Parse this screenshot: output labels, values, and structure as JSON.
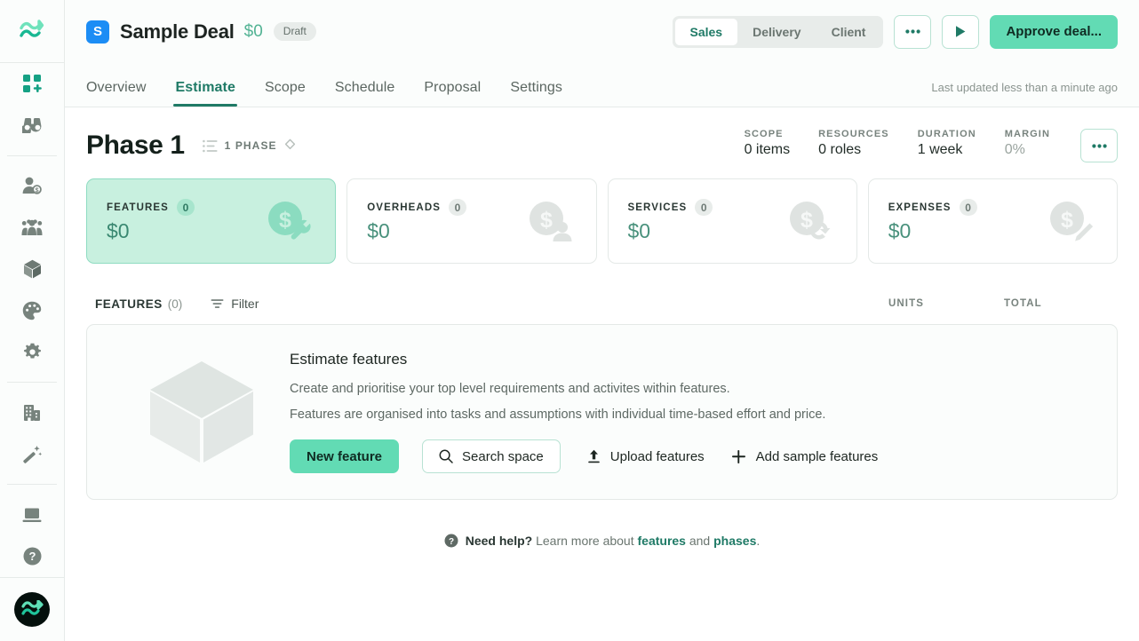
{
  "rail": {
    "logo_icon": "wave-logo-icon",
    "items": [
      {
        "name": "apps-add-icon",
        "active": true
      },
      {
        "name": "binoculars-icon",
        "active": false
      },
      {
        "name": "person-dollar-icon",
        "active": false
      },
      {
        "name": "team-icon",
        "active": false
      },
      {
        "name": "package-icon",
        "active": false
      },
      {
        "name": "palette-icon",
        "active": false
      },
      {
        "name": "gear-icon",
        "active": false
      },
      {
        "name": "building-icon",
        "active": false
      },
      {
        "name": "magic-wand-icon",
        "active": false
      },
      {
        "name": "laptop-icon",
        "active": false
      },
      {
        "name": "help-circle-icon",
        "active": false
      }
    ],
    "avatar_icon": "wave-avatar-icon"
  },
  "topbar": {
    "deal_logo_letter": "S",
    "deal_title": "Sample Deal",
    "deal_price": "$0",
    "status_badge": "Draft",
    "segments": [
      {
        "label": "Sales",
        "active": true
      },
      {
        "label": "Delivery",
        "active": false
      },
      {
        "label": "Client",
        "active": false
      }
    ],
    "more_button": "•••",
    "play_button": "play-icon",
    "approve_label": "Approve deal..."
  },
  "tabs": [
    {
      "label": "Overview",
      "active": false
    },
    {
      "label": "Estimate",
      "active": true
    },
    {
      "label": "Scope",
      "active": false
    },
    {
      "label": "Schedule",
      "active": false
    },
    {
      "label": "Proposal",
      "active": false
    },
    {
      "label": "Settings",
      "active": false
    }
  ],
  "last_updated": "Last updated less than a minute ago",
  "phase": {
    "title": "Phase 1",
    "chip_label": "1 PHASE",
    "metrics": [
      {
        "label": "SCOPE",
        "value": "0 items",
        "muted": false
      },
      {
        "label": "RESOURCES",
        "value": "0 roles",
        "muted": false
      },
      {
        "label": "DURATION",
        "value": "1 week",
        "muted": false
      },
      {
        "label": "MARGIN",
        "value": "0%",
        "muted": true
      }
    ],
    "more_button": "•••"
  },
  "cards": [
    {
      "label": "FEATURES",
      "count": "0",
      "value": "$0",
      "icon": "coin-wrench-icon",
      "selected": true
    },
    {
      "label": "OVERHEADS",
      "count": "0",
      "value": "$0",
      "icon": "coin-person-icon",
      "selected": false
    },
    {
      "label": "SERVICES",
      "count": "0",
      "value": "$0",
      "icon": "coin-refresh-icon",
      "selected": false
    },
    {
      "label": "EXPENSES",
      "count": "0",
      "value": "$0",
      "icon": "coin-pencil-icon",
      "selected": false
    }
  ],
  "list_header": {
    "title": "FEATURES",
    "count": "(0)",
    "filter_label": "Filter",
    "units_label": "UNITS",
    "total_label": "TOTAL"
  },
  "empty_state": {
    "art_icon": "cube-illustration-icon",
    "title": "Estimate features",
    "paragraph_1": "Create and prioritise your top level requirements and activites within features.",
    "paragraph_2": "Features are organised into tasks and assumptions with individual time-based effort and price.",
    "actions": {
      "new_feature": "New feature",
      "search_space": "Search space",
      "upload_features": "Upload features",
      "add_sample_features": "Add sample features"
    }
  },
  "footer": {
    "help_icon": "help-circle-icon",
    "bold_text": "Need help?",
    "text": " Learn more about ",
    "link_1": "features",
    "conjunction": " and ",
    "link_2": "phases",
    "period": "."
  },
  "colors": {
    "accent": "#62dbb4",
    "accent_dark": "#1f7a66",
    "selected_card_bg": "#c8f0df",
    "deal_logo_blue": "#1c8df5"
  }
}
